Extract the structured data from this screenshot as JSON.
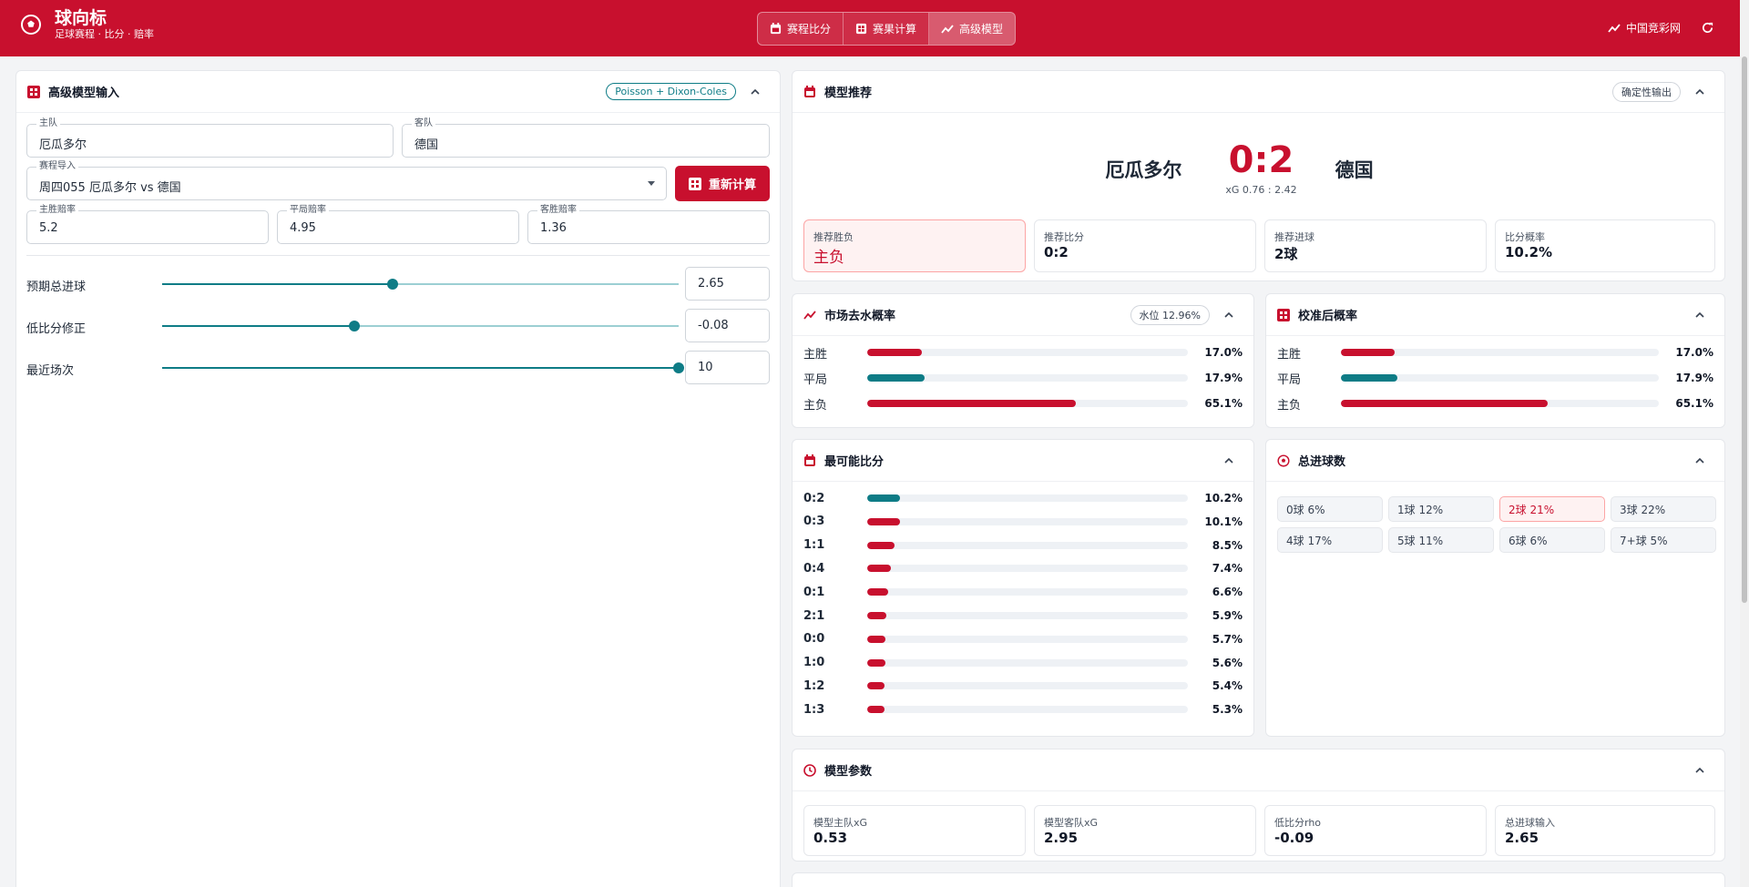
{
  "header": {
    "title": "球向标",
    "subtitle": "足球赛程 · 比分 · 赔率",
    "tabs": [
      {
        "label": "赛程比分",
        "icon": "calendar-icon"
      },
      {
        "label": "赛果计算",
        "icon": "calculator-icon"
      },
      {
        "label": "高级模型",
        "icon": "trend-icon"
      }
    ],
    "active_tab": "高级模型",
    "site_link": "中国竞彩网",
    "colors": {
      "brand": "#c8102e",
      "accent": "#0e7c86"
    }
  },
  "input_panel": {
    "title": "高级模型输入",
    "badge": "Poisson + Dixon-Coles",
    "home_label": "主队",
    "home_value": "厄瓜多尔",
    "away_label": "客队",
    "away_value": "德国",
    "match_label": "赛程导入",
    "match_value": "周四055 厄瓜多尔 vs 德国",
    "recalc_label": "重新计算",
    "odds": [
      {
        "label": "主胜赔率",
        "value": "5.2"
      },
      {
        "label": "平局赔率",
        "value": "4.95"
      },
      {
        "label": "客胜赔率",
        "value": "1.36"
      }
    ],
    "sliders": [
      {
        "label": "预期总进球",
        "value": "2.65",
        "fraction": 0.446
      },
      {
        "label": "低比分修正",
        "value": "-0.08",
        "fraction": 0.373
      },
      {
        "label": "最近场次",
        "value": "10",
        "fraction": 1.0
      }
    ]
  },
  "recommend": {
    "title": "模型推荐",
    "badge": "确定性输出",
    "home": "厄瓜多尔",
    "away": "德国",
    "score": "0:2",
    "xg": "xG 0.76 : 2.42",
    "stats": [
      {
        "label": "推荐胜负",
        "value": "主负"
      },
      {
        "label": "推荐比分",
        "value": "0:2"
      },
      {
        "label": "推荐进球",
        "value": "2球"
      },
      {
        "label": "比分概率",
        "value": "10.2%"
      }
    ]
  },
  "market": {
    "title": "市场去水概率",
    "badge": "水位 12.96%",
    "rows": [
      {
        "label": "主胜",
        "value": "17.0%",
        "pct": 17.0,
        "color": "#c8102e"
      },
      {
        "label": "平局",
        "value": "17.9%",
        "pct": 17.9,
        "color": "#0e7c86"
      },
      {
        "label": "主负",
        "value": "65.1%",
        "pct": 65.1,
        "color": "#c8102e"
      }
    ]
  },
  "calibrated": {
    "title": "校准后概率",
    "rows": [
      {
        "label": "主胜",
        "value": "17.0%",
        "pct": 17.0,
        "color": "#c8102e"
      },
      {
        "label": "平局",
        "value": "17.9%",
        "pct": 17.9,
        "color": "#0e7c86"
      },
      {
        "label": "主负",
        "value": "65.1%",
        "pct": 65.1,
        "color": "#c8102e"
      }
    ]
  },
  "scores": {
    "title": "最可能比分",
    "rows": [
      {
        "label": "0:2",
        "value": "10.2%",
        "pct": 10.2,
        "color": "#0e7c86"
      },
      {
        "label": "0:3",
        "value": "10.1%",
        "pct": 10.1,
        "color": "#c8102e"
      },
      {
        "label": "1:1",
        "value": "8.5%",
        "pct": 8.5,
        "color": "#c8102e"
      },
      {
        "label": "0:4",
        "value": "7.4%",
        "pct": 7.4,
        "color": "#c8102e"
      },
      {
        "label": "0:1",
        "value": "6.6%",
        "pct": 6.6,
        "color": "#c8102e"
      },
      {
        "label": "2:1",
        "value": "5.9%",
        "pct": 5.9,
        "color": "#c8102e"
      },
      {
        "label": "0:0",
        "value": "5.7%",
        "pct": 5.7,
        "color": "#c8102e"
      },
      {
        "label": "1:0",
        "value": "5.6%",
        "pct": 5.6,
        "color": "#c8102e"
      },
      {
        "label": "1:2",
        "value": "5.4%",
        "pct": 5.4,
        "color": "#c8102e"
      },
      {
        "label": "1:3",
        "value": "5.3%",
        "pct": 5.3,
        "color": "#c8102e"
      }
    ]
  },
  "total_goals": {
    "title": "总进球数",
    "chips": [
      "0球 6%",
      "1球 12%",
      "2球 21%",
      "3球 22%",
      "4球 17%",
      "5球 11%",
      "6球 6%",
      "7+球 5%"
    ],
    "highlighted": "2球 21%"
  },
  "params": {
    "title": "模型参数",
    "stats": [
      {
        "label": "模型主队xG",
        "value": "0.53"
      },
      {
        "label": "模型客队xG",
        "value": "2.95"
      },
      {
        "label": "低比分rho",
        "value": "-0.09"
      },
      {
        "label": "总进球输入",
        "value": "2.65"
      }
    ]
  }
}
